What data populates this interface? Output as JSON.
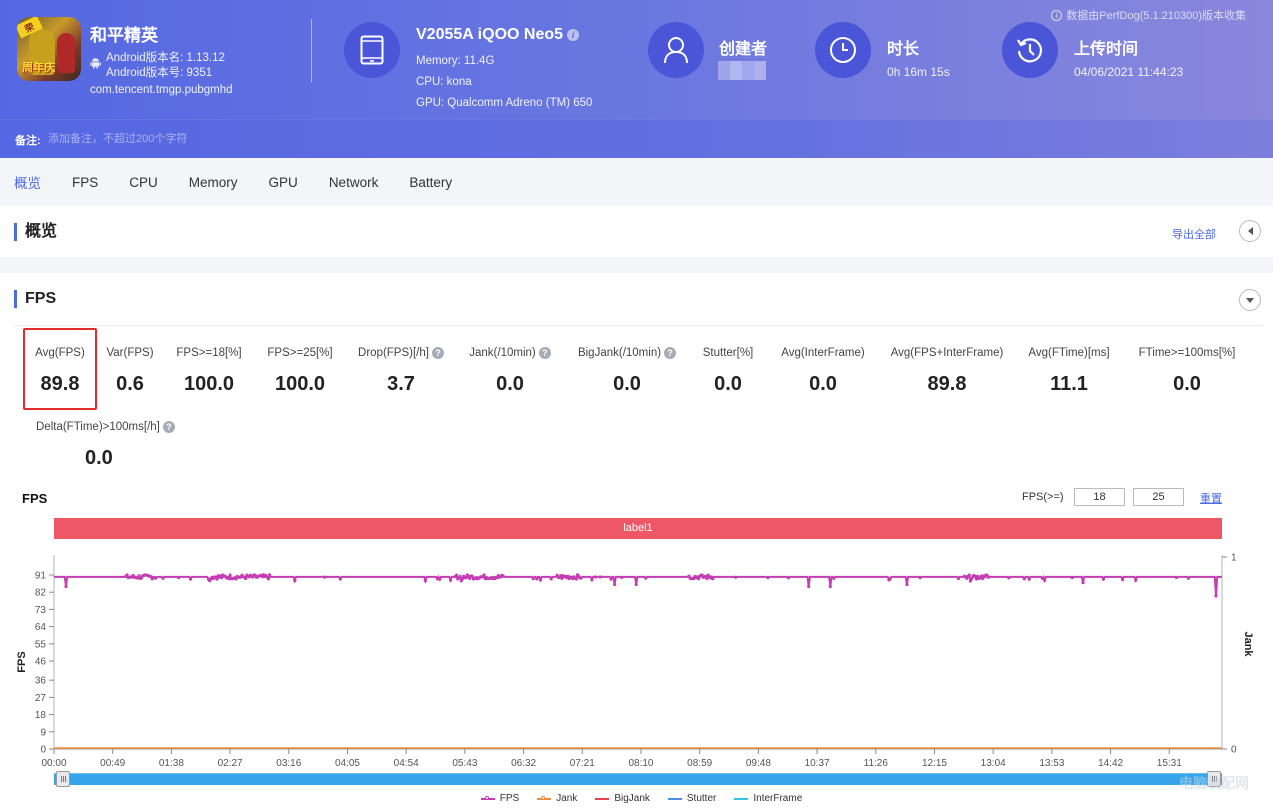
{
  "header": {
    "collector_note": "数据由PerfDog(5.1.210300)版本收集",
    "app": {
      "name": "和平精英",
      "icon_badge_top": "荣",
      "icon_badge_bottom": "周年庆",
      "android_version_name": "Android版本名: 1.13.12",
      "android_version_code": "Android版本号: 9351",
      "package": "com.tencent.tmgp.pubgmhd"
    },
    "device": {
      "title": "V2055A iQOO Neo5",
      "info_icon": "i",
      "memory": "Memory: 11.4G",
      "cpu": "CPU: kona",
      "gpu": "GPU: Qualcomm Adreno (TM) 650"
    },
    "creator": {
      "title": "创建者",
      "value": ""
    },
    "duration": {
      "title": "时长",
      "value": "0h 16m 15s"
    },
    "upload": {
      "title": "上传时间",
      "value": "04/06/2021 11:44:23"
    }
  },
  "remark": {
    "label": "备注:",
    "placeholder": "添加备注，不超过200个字符"
  },
  "tabs": [
    {
      "label": "概览",
      "active": true
    },
    {
      "label": "FPS"
    },
    {
      "label": "CPU"
    },
    {
      "label": "Memory"
    },
    {
      "label": "GPU"
    },
    {
      "label": "Network"
    },
    {
      "label": "Battery"
    }
  ],
  "overview": {
    "title": "概览",
    "export_label": "导出全部"
  },
  "fps_section": {
    "title": "FPS",
    "metrics": [
      {
        "label": "Avg(FPS)",
        "value": "89.8",
        "help": false,
        "highlighted": true
      },
      {
        "label": "Var(FPS)",
        "value": "0.6",
        "help": false
      },
      {
        "label": "FPS>=18[%]",
        "value": "100.0",
        "help": false
      },
      {
        "label": "FPS>=25[%]",
        "value": "100.0",
        "help": false
      },
      {
        "label": "Drop(FPS)[/h]",
        "value": "3.7",
        "help": true
      },
      {
        "label": "Jank(/10min)",
        "value": "0.0",
        "help": true
      },
      {
        "label": "BigJank(/10min)",
        "value": "0.0",
        "help": true
      },
      {
        "label": "Stutter[%]",
        "value": "0.0",
        "help": false
      },
      {
        "label": "Avg(InterFrame)",
        "value": "0.0",
        "help": false
      },
      {
        "label": "Avg(FPS+InterFrame)",
        "value": "89.8",
        "help": false
      },
      {
        "label": "Avg(FTime)[ms]",
        "value": "11.1",
        "help": false
      },
      {
        "label": "FTime>=100ms[%]",
        "value": "0.0",
        "help": false
      },
      {
        "label": "Delta(FTime)>100ms[/h]",
        "value": "0.0",
        "help": true
      }
    ],
    "help_glyph": "?"
  },
  "chart_controls": {
    "title": "FPS",
    "threshold_label": "FPS(>=)",
    "threshold_1": "18",
    "threshold_2": "25",
    "reset_label": "重置",
    "band_label": "label1"
  },
  "watermark": "电脑装配网",
  "chart_data": {
    "type": "line",
    "title": "FPS",
    "xlabel": "",
    "ylabel": "FPS",
    "y2label": "Jank",
    "ylim": [
      0,
      91
    ],
    "y2lim": [
      0,
      1
    ],
    "yticks": [
      0,
      9,
      18,
      27,
      36,
      46,
      55,
      64,
      73,
      82,
      91
    ],
    "y2ticks": [
      0,
      1
    ],
    "xticks": [
      "00:00",
      "00:49",
      "01:38",
      "02:27",
      "03:16",
      "04:05",
      "04:54",
      "05:43",
      "06:32",
      "07:21",
      "08:10",
      "08:59",
      "09:48",
      "10:37",
      "11:26",
      "12:15",
      "13:04",
      "13:53",
      "14:42",
      "15:31"
    ],
    "duration_seconds": 975,
    "grid": false,
    "legend_position": "bottom",
    "series": [
      {
        "name": "FPS",
        "color": "#c43db4",
        "baseline": 90,
        "marker": "circle",
        "dips": [
          {
            "t": 10,
            "v": 85
          },
          {
            "t": 130,
            "v": 88
          },
          {
            "t": 310,
            "v": 88
          },
          {
            "t": 340,
            "v": 88
          },
          {
            "t": 415,
            "v": 89
          },
          {
            "t": 468,
            "v": 86
          },
          {
            "t": 486,
            "v": 86
          },
          {
            "t": 630,
            "v": 85
          },
          {
            "t": 648,
            "v": 85
          },
          {
            "t": 712,
            "v": 86
          },
          {
            "t": 765,
            "v": 88
          },
          {
            "t": 859,
            "v": 87
          },
          {
            "t": 970,
            "v": 80
          }
        ],
        "dense_clusters": [
          [
            60,
            85
          ],
          [
            130,
            180
          ],
          [
            335,
            375
          ],
          [
            420,
            440
          ],
          [
            530,
            550
          ],
          [
            760,
            780
          ],
          [
            1000,
            1030
          ]
        ]
      },
      {
        "name": "Jank",
        "color": "#f08a3c",
        "values_constant": 0,
        "marker": "circle"
      },
      {
        "name": "BigJank",
        "color": "#e8404a",
        "values_constant": 0
      },
      {
        "name": "Stutter",
        "color": "#4a8de8",
        "values_constant": 0
      },
      {
        "name": "InterFrame",
        "color": "#38c4e8",
        "values_constant": 0
      }
    ]
  }
}
